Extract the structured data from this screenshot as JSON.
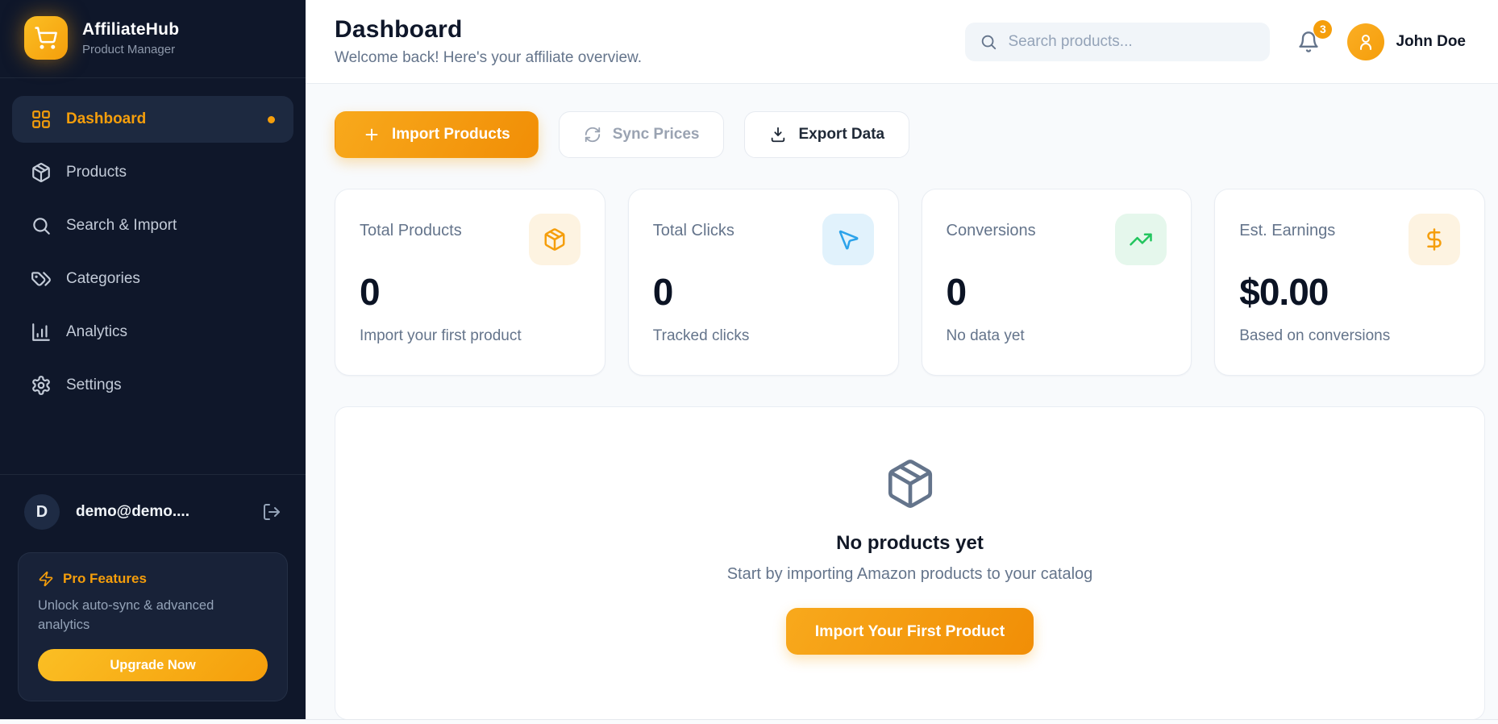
{
  "brand": {
    "name": "AffiliateHub",
    "subtitle": "Product Manager"
  },
  "sidebar": {
    "items": [
      {
        "label": "Dashboard",
        "icon": "dashboard-grid-icon",
        "active": true
      },
      {
        "label": "Products",
        "icon": "package-icon",
        "active": false
      },
      {
        "label": "Search & Import",
        "icon": "search-icon",
        "active": false
      },
      {
        "label": "Categories",
        "icon": "tags-icon",
        "active": false
      },
      {
        "label": "Analytics",
        "icon": "bar-chart-icon",
        "active": false
      },
      {
        "label": "Settings",
        "icon": "gear-icon",
        "active": false
      }
    ],
    "user": {
      "initial": "D",
      "email": "demo@demo...."
    },
    "pro": {
      "title": "Pro Features",
      "description": "Unlock auto-sync & advanced analytics",
      "cta": "Upgrade Now"
    }
  },
  "header": {
    "title": "Dashboard",
    "subtitle": "Welcome back! Here's your affiliate overview.",
    "search_placeholder": "Search products...",
    "notification_count": "3",
    "user_name": "John Doe"
  },
  "actions": {
    "import_label": "Import Products",
    "sync_label": "Sync Prices",
    "export_label": "Export Data"
  },
  "stats": [
    {
      "label": "Total Products",
      "value": "0",
      "note": "Import your first product",
      "icon": "package-icon",
      "accent": "#f59e0b",
      "accent_bg": "#fdf3e1"
    },
    {
      "label": "Total Clicks",
      "value": "0",
      "note": "Tracked clicks",
      "icon": "cursor-icon",
      "accent": "#2ca3ea",
      "accent_bg": "#e1f2fc"
    },
    {
      "label": "Conversions",
      "value": "0",
      "note": "No data yet",
      "icon": "trending-up-icon",
      "accent": "#22c55e",
      "accent_bg": "#e5f7ec"
    },
    {
      "label": "Est. Earnings",
      "value": "$0.00",
      "note": "Based on conversions",
      "icon": "dollar-icon",
      "accent": "#f59e0b",
      "accent_bg": "#fdf3e1"
    }
  ],
  "empty_state": {
    "title": "No products yet",
    "subtitle": "Start by importing Amazon products to your catalog",
    "cta": "Import Your First Product"
  },
  "colors": {
    "sidebar_bg": "#0f172a",
    "sidebar_active_bg": "#1d2940",
    "accent_orange": "#f59e0b",
    "content_bg": "#f8fafc",
    "text_dark": "#0f172a",
    "text_muted": "#64748b"
  }
}
